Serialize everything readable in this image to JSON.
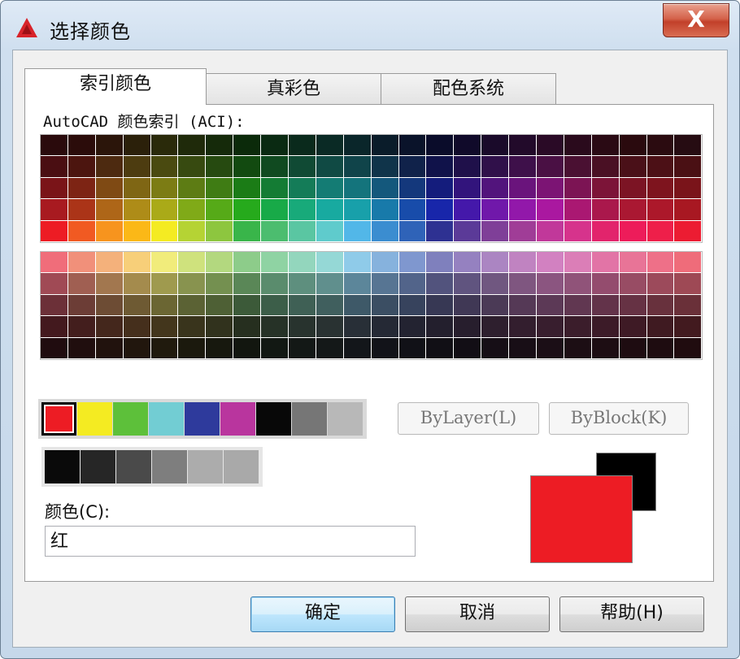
{
  "window": {
    "title": "选择颜色",
    "close_glyph": "X"
  },
  "tabs": [
    {
      "label": "索引颜色",
      "active": true
    },
    {
      "label": "真彩色",
      "active": false
    },
    {
      "label": "配色系统",
      "active": false
    }
  ],
  "aci": {
    "label": "AutoCAD 颜色索引 (ACI):",
    "top_grid": [
      [
        "#2a0a0c",
        "#2b0c0a",
        "#2b150a",
        "#2b200a",
        "#2a2a0a",
        "#1f2a0a",
        "#152a0a",
        "#0b2a0a",
        "#0a2a12",
        "#0a2a1c",
        "#0a2a25",
        "#0a262a",
        "#0a1c2a",
        "#0a132a",
        "#0a0c2a",
        "#100a2a",
        "#1a0a2a",
        "#220a2a",
        "#2a0a26",
        "#2a0a1c",
        "#2a0a14",
        "#2a0a0e",
        "#2b0b10",
        "#260c12"
      ],
      [
        "#4a0e12",
        "#4c150f",
        "#4d2a10",
        "#4d3c10",
        "#4a4a10",
        "#374a10",
        "#264a10",
        "#124a10",
        "#104a20",
        "#104a34",
        "#104a44",
        "#10444a",
        "#10344a",
        "#10224a",
        "#10124a",
        "#1f104a",
        "#30104a",
        "#3e104a",
        "#4a1044",
        "#4a1032",
        "#4a1024",
        "#4a1018",
        "#4c1016",
        "#4a1014"
      ],
      [
        "#7a1418",
        "#7d2414",
        "#7f4a14",
        "#7f6614",
        "#7c7c14",
        "#5d7c14",
        "#3f7c14",
        "#1b7c16",
        "#147c34",
        "#147c58",
        "#147c74",
        "#14747c",
        "#14587c",
        "#14387c",
        "#141c7c",
        "#32147c",
        "#52147c",
        "#6a147c",
        "#7c1474",
        "#7c1454",
        "#7c1438",
        "#7c1424",
        "#7e141e",
        "#7a141a"
      ],
      [
        "#a81a20",
        "#ab3418",
        "#ae6618",
        "#ae8c18",
        "#aaaa18",
        "#80aa18",
        "#56aa18",
        "#26aa1c",
        "#18aa48",
        "#18aa7a",
        "#18aaa0",
        "#18a0aa",
        "#187aaa",
        "#184caa",
        "#1826aa",
        "#4418aa",
        "#7018aa",
        "#9218aa",
        "#aa18a0",
        "#aa1872",
        "#aa184c",
        "#aa1832",
        "#ac182a",
        "#a81822"
      ],
      [
        "#ed1c24",
        "#f15a22",
        "#f7941e",
        "#fbb817",
        "#f4eb22",
        "#b5d334",
        "#8dc63f",
        "#39b54a",
        "#4cbd6f",
        "#5ac6a2",
        "#5fcbcc",
        "#52b7e8",
        "#3b8dd0",
        "#2f63b8",
        "#2e3192",
        "#5b3a98",
        "#7f3f98",
        "#a03d97",
        "#c1389a",
        "#d6338c",
        "#e2246c",
        "#ed1c5a",
        "#ee1f4a",
        "#ec1c32"
      ]
    ],
    "bottom_grid": [
      [
        "#f06d7a",
        "#f1907a",
        "#f4b17b",
        "#f7cf79",
        "#f1ec7b",
        "#cfe27d",
        "#b3d87f",
        "#8dcc8a",
        "#8fd3a3",
        "#93d6bd",
        "#95d8d6",
        "#8fcbe9",
        "#86b2dd",
        "#7f97cf",
        "#7f80bd",
        "#9581c0",
        "#ab85c2",
        "#c083c1",
        "#d281c1",
        "#db7eb7",
        "#e274a6",
        "#e87497",
        "#ee7088",
        "#ef6c7a"
      ],
      [
        "#a04a55",
        "#a05f52",
        "#a2774f",
        "#a48b4d",
        "#9f9a4e",
        "#88934f",
        "#749050",
        "#5a8757",
        "#5a8c6d",
        "#5e8f7e",
        "#608f8d",
        "#5c869a",
        "#577593",
        "#52648a",
        "#52537d",
        "#60547f",
        "#705780",
        "#7f5680",
        "#8b5580",
        "#905379",
        "#944c6e",
        "#984c64",
        "#9c4a5b",
        "#9e4955"
      ],
      [
        "#6c3038",
        "#6c3d36",
        "#6d4c34",
        "#6e5a33",
        "#6b6633",
        "#5b6234",
        "#4e6035",
        "#3c5a39",
        "#3c5e49",
        "#3f6055",
        "#405f5e",
        "#3e5968",
        "#3b4e63",
        "#37435d",
        "#373854",
        "#403855",
        "#4b3a56",
        "#553956",
        "#5c3956",
        "#613751",
        "#63334a",
        "#663244",
        "#68313d",
        "#6a3039"
      ],
      [
        "#43191e",
        "#431e1d",
        "#44271c",
        "#452f1c",
        "#43361c",
        "#39341c",
        "#31321d",
        "#262f1f",
        "#263227",
        "#28332e",
        "#293232",
        "#282f37",
        "#252935",
        "#232331",
        "#231f2d",
        "#271e2d",
        "#2e1f2e",
        "#331e2e",
        "#381e2e",
        "#3b1d2b",
        "#3c1b28",
        "#3e1a25",
        "#3f1a21",
        "#421a1f"
      ],
      [
        "#200c0f",
        "#200e0e",
        "#21120d",
        "#21160d",
        "#201a0d",
        "#1b190d",
        "#17180e",
        "#12160f",
        "#121813",
        "#131816",
        "#141818",
        "#13161a",
        "#121319",
        "#111117",
        "#110f15",
        "#120e15",
        "#160e16",
        "#180e16",
        "#1b0e16",
        "#1c0e14",
        "#1d0d13",
        "#1e0c11",
        "#1e0c10",
        "#200c0f"
      ]
    ]
  },
  "standard_colors": {
    "row1": [
      "#ed1c24",
      "#f4eb22",
      "#5dc03a",
      "#72cdd3",
      "#2e3a9c",
      "#b9359e",
      "#080808",
      "#767676",
      "#b8b8b8"
    ],
    "row2": [
      "#0a0a0a",
      "#262626",
      "#4a4a4a",
      "#7e7e7e",
      "#acacac",
      "#a9a9a9"
    ],
    "selected_index": 0
  },
  "buttons": {
    "bylayer": "ByLayer(L)",
    "byblock": "ByBlock(K)",
    "ok": "确定",
    "cancel": "取消",
    "help": "帮助(H)"
  },
  "color_field": {
    "label": "颜色(C):",
    "value": "红"
  },
  "preview": {
    "new_color": "#ed1c24",
    "old_color": "#000000"
  }
}
